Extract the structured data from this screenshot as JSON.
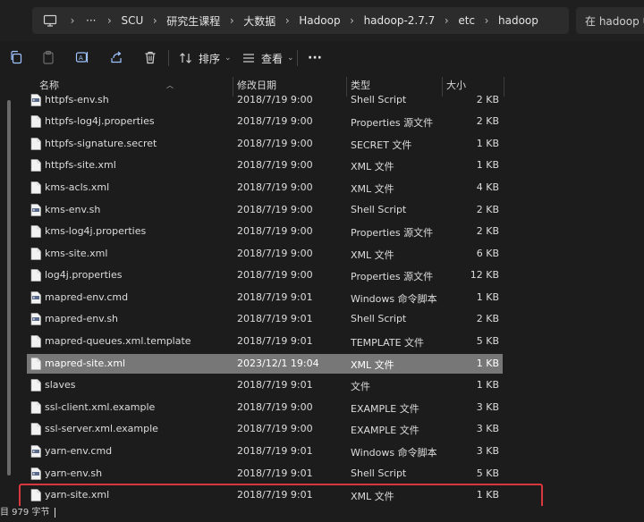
{
  "address": {
    "breadcrumbs": [
      "SCU",
      "研究生课程",
      "大数据",
      "Hadoop",
      "hadoop-2.7.7",
      "etc",
      "hadoop"
    ],
    "search_placeholder": "在 hadoop 中"
  },
  "toolbar": {
    "sort_label": "排序",
    "view_label": "查看",
    "more_label": "···"
  },
  "columns": {
    "name": "名称",
    "modified": "修改日期",
    "type": "类型",
    "size": "大小"
  },
  "files": [
    {
      "name": "httpfs-env.sh",
      "modified": "2018/7/19 9:00",
      "type": "Shell Script",
      "size": "2 KB",
      "icon": "script-file-icon"
    },
    {
      "name": "httpfs-log4j.properties",
      "modified": "2018/7/19 9:00",
      "type": "Properties 源文件",
      "size": "2 KB",
      "icon": "document-file-icon"
    },
    {
      "name": "httpfs-signature.secret",
      "modified": "2018/7/19 9:00",
      "type": "SECRET 文件",
      "size": "1 KB",
      "icon": "document-file-icon"
    },
    {
      "name": "httpfs-site.xml",
      "modified": "2018/7/19 9:00",
      "type": "XML 文件",
      "size": "1 KB",
      "icon": "document-file-icon"
    },
    {
      "name": "kms-acls.xml",
      "modified": "2018/7/19 9:00",
      "type": "XML 文件",
      "size": "4 KB",
      "icon": "document-file-icon"
    },
    {
      "name": "kms-env.sh",
      "modified": "2018/7/19 9:00",
      "type": "Shell Script",
      "size": "2 KB",
      "icon": "script-file-icon"
    },
    {
      "name": "kms-log4j.properties",
      "modified": "2018/7/19 9:00",
      "type": "Properties 源文件",
      "size": "2 KB",
      "icon": "document-file-icon"
    },
    {
      "name": "kms-site.xml",
      "modified": "2018/7/19 9:00",
      "type": "XML 文件",
      "size": "6 KB",
      "icon": "document-file-icon"
    },
    {
      "name": "log4j.properties",
      "modified": "2018/7/19 9:00",
      "type": "Properties 源文件",
      "size": "12 KB",
      "icon": "document-file-icon"
    },
    {
      "name": "mapred-env.cmd",
      "modified": "2018/7/19 9:01",
      "type": "Windows 命令脚本",
      "size": "1 KB",
      "icon": "script-file-icon"
    },
    {
      "name": "mapred-env.sh",
      "modified": "2018/7/19 9:01",
      "type": "Shell Script",
      "size": "2 KB",
      "icon": "script-file-icon"
    },
    {
      "name": "mapred-queues.xml.template",
      "modified": "2018/7/19 9:01",
      "type": "TEMPLATE 文件",
      "size": "5 KB",
      "icon": "document-file-icon"
    },
    {
      "name": "mapred-site.xml",
      "modified": "2023/12/1 19:04",
      "type": "XML 文件",
      "size": "1 KB",
      "icon": "document-file-icon",
      "selected": true
    },
    {
      "name": "slaves",
      "modified": "2018/7/19 9:01",
      "type": "文件",
      "size": "1 KB",
      "icon": "document-file-icon"
    },
    {
      "name": "ssl-client.xml.example",
      "modified": "2018/7/19 9:00",
      "type": "EXAMPLE 文件",
      "size": "3 KB",
      "icon": "document-file-icon"
    },
    {
      "name": "ssl-server.xml.example",
      "modified": "2018/7/19 9:00",
      "type": "EXAMPLE 文件",
      "size": "3 KB",
      "icon": "document-file-icon"
    },
    {
      "name": "yarn-env.cmd",
      "modified": "2018/7/19 9:01",
      "type": "Windows 命令脚本",
      "size": "3 KB",
      "icon": "script-file-icon"
    },
    {
      "name": "yarn-env.sh",
      "modified": "2018/7/19 9:01",
      "type": "Shell Script",
      "size": "5 KB",
      "icon": "script-file-icon"
    },
    {
      "name": "yarn-site.xml",
      "modified": "2018/7/19 9:01",
      "type": "XML 文件",
      "size": "1 KB",
      "icon": "document-file-icon",
      "highlighted": true
    }
  ],
  "status": {
    "text": "目  979 字节"
  },
  "colors": {
    "background": "#1c1c1c",
    "selected_row": "#777777",
    "highlight_border": "#d8373c"
  }
}
